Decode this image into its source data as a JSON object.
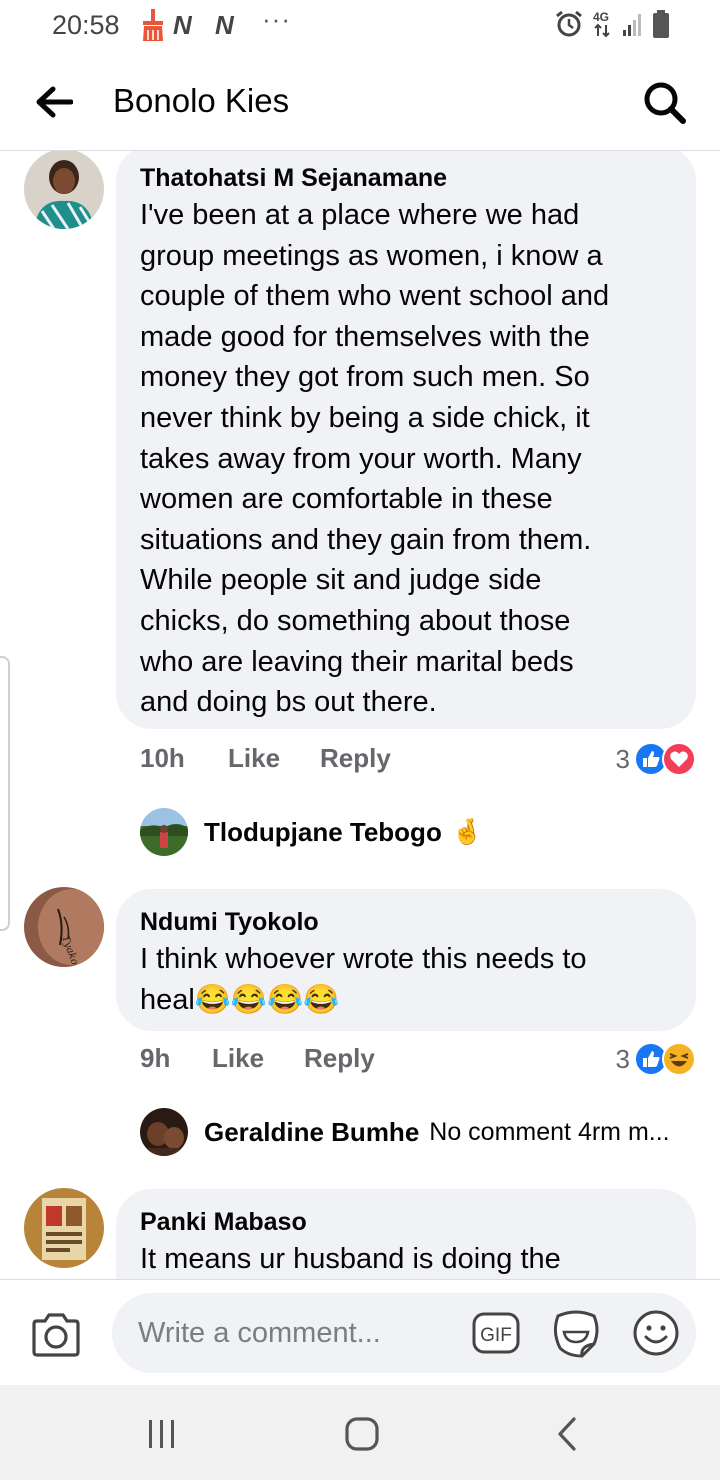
{
  "status_bar": {
    "time": "20:58",
    "dots": "···",
    "network_label": "4G",
    "icons": [
      "cleaner-icon",
      "nn-news-icon",
      "nn-news-icon-2",
      "alarm-icon",
      "4g-data-icon",
      "signal-icon",
      "battery-icon"
    ]
  },
  "header": {
    "title": "Bonolo Kies",
    "back_icon": "arrow-left-icon",
    "search_icon": "search-icon"
  },
  "comments": [
    {
      "author": "Thatohatsi M Sejanamane",
      "lines": [
        "I've been at a place where we had",
        "group meetings as women, i know a",
        "couple of them who went school and",
        "made good for themselves with the",
        "money they got from such men. So",
        "never think by being a side chick, it",
        "takes away from your worth. Many",
        "women are comfortable in these",
        "situations and they gain from them.",
        "While people sit and judge side",
        "chicks, do something about those",
        "who are leaving their marital beds",
        "and doing bs out there."
      ],
      "time": "10h",
      "like_label": "Like",
      "reply_label": "Reply",
      "reaction_count": "3",
      "reactions": [
        "like-reaction-icon",
        "love-reaction-icon"
      ],
      "reply_preview": {
        "name": "Tlodupjane Tebogo",
        "text": "🤞"
      }
    },
    {
      "author": "Ndumi Tyokolo",
      "lines": [
        "I think whoever wrote this needs to",
        "heal😂😂😂😂"
      ],
      "time": "9h",
      "like_label": "Like",
      "reply_label": "Reply",
      "reaction_count": "3",
      "reactions": [
        "like-reaction-icon",
        "haha-reaction-icon"
      ],
      "reply_preview": {
        "name": "Geraldine Bumhe",
        "text": "No comment 4rm m..."
      }
    },
    {
      "author": "Panki Mabaso",
      "lines": [
        "It means ur husband  is doing the"
      ]
    }
  ],
  "composer": {
    "placeholder": "Write a comment...",
    "gif_label": "GIF",
    "icons": [
      "camera-icon",
      "gif-icon",
      "sticker-icon",
      "emoji-icon"
    ]
  },
  "navbar": {
    "icons": [
      "recent-apps-icon",
      "home-icon",
      "back-icon"
    ]
  },
  "colors": {
    "bubble": "#f0f2f5",
    "meta_text": "#65676b",
    "like_blue": "#1877f2",
    "love_red": "#f33e58",
    "haha_yellow": "#f7b125",
    "navbar_bg": "#f1f1f1"
  }
}
